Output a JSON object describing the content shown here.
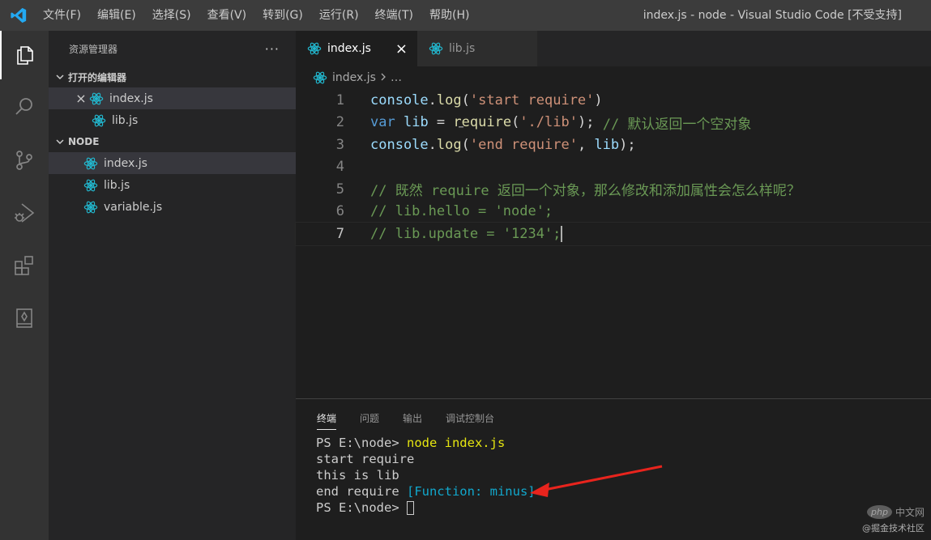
{
  "titlebar": {
    "menus": [
      "文件(F)",
      "编辑(E)",
      "选择(S)",
      "查看(V)",
      "转到(G)",
      "运行(R)",
      "终端(T)",
      "帮助(H)"
    ],
    "window_title": "index.js - node - Visual Studio Code [不受支持]"
  },
  "activity_bar": {
    "icons": [
      "explorer-icon",
      "search-icon",
      "source-control-icon",
      "run-debug-icon",
      "extensions-icon",
      "notebook-icon"
    ]
  },
  "sidebar": {
    "title": "资源管理器",
    "more": "···",
    "open_editors": {
      "label": "打开的编辑器",
      "items": [
        {
          "name": "index.js",
          "close": "×"
        },
        {
          "name": "lib.js"
        }
      ]
    },
    "folder": {
      "label": "NODE",
      "items": [
        "index.js",
        "lib.js",
        "variable.js"
      ]
    }
  },
  "tabs": [
    {
      "label": "index.js",
      "close": "×"
    },
    {
      "label": "lib.js"
    }
  ],
  "breadcrumb": {
    "file": "index.js",
    "rest": "…"
  },
  "code_lines": [
    {
      "n": "1"
    },
    {
      "n": "2"
    },
    {
      "n": "3"
    },
    {
      "n": "4"
    },
    {
      "n": "5"
    },
    {
      "n": "6"
    },
    {
      "n": "7"
    }
  ],
  "code": {
    "l1": {
      "obj": "console",
      "dot": ".",
      "fn": "log",
      "open": "(",
      "str": "'start require'",
      "close": ")"
    },
    "l2": {
      "kw": "var",
      "sp1": " ",
      "v": "lib",
      "eq": " = ",
      "fn": "require",
      "open": "(",
      "str": "'./lib'",
      "close": ");",
      "sp2": " ",
      "cm": "// 默认返回一个空对象"
    },
    "l3": {
      "obj": "console",
      "dot": ".",
      "fn": "log",
      "open": "(",
      "str": "'end require'",
      "comma": ", ",
      "v": "lib",
      "close": ");"
    },
    "l5": {
      "cm": "// 既然 require 返回一个对象，那么修改和添加属性会怎么样呢？"
    },
    "l6": {
      "cm": "// lib.hello = 'node';"
    },
    "l7": {
      "cm": "// lib.update = '1234';"
    }
  },
  "panel": {
    "tabs": [
      "终端",
      "问题",
      "输出",
      "调试控制台"
    ],
    "terminal": {
      "l1_prompt": "PS E:\\node> ",
      "l1_cmd": "node index.js",
      "l2": "start require",
      "l3": "this is lib",
      "l4_text": "end require ",
      "l4_fn": "[Function: minus]",
      "l5_prompt": "PS E:\\node> "
    }
  },
  "watermark": {
    "php_badge": "php",
    "php_site": "中文网",
    "credit": "@掘金技术社区"
  },
  "colors": {
    "accent_blue": "#007acc",
    "annotation_red": "#e8241d"
  }
}
